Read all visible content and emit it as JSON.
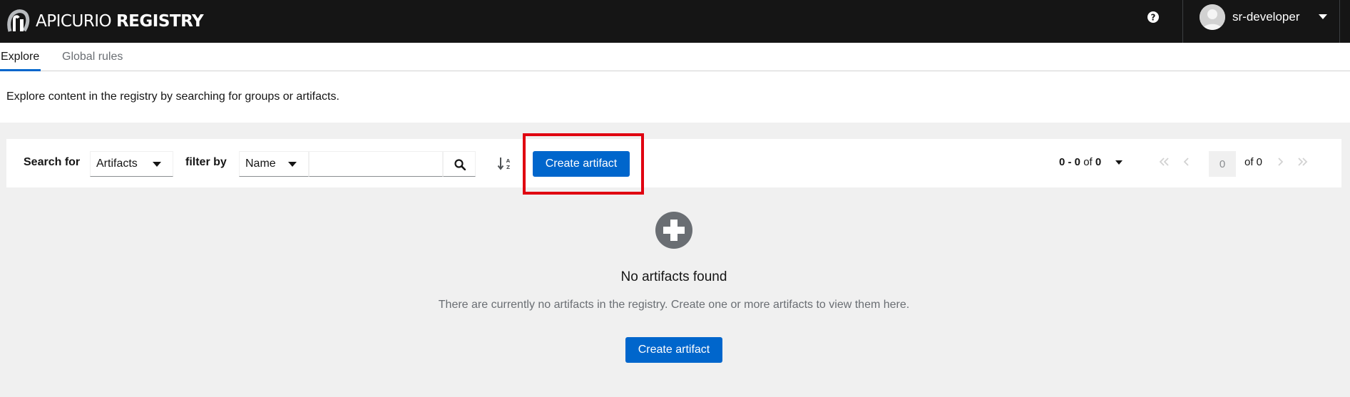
{
  "masthead": {
    "brand_light": "APICURIO",
    "brand_bold": "REGISTRY",
    "user_name": "sr-developer",
    "background_color": "#151515"
  },
  "tabs": [
    {
      "label": "Explore",
      "active": true
    },
    {
      "label": "Global rules",
      "active": false
    }
  ],
  "description": "Explore content in the registry by searching for groups or artifacts.",
  "toolbar": {
    "search_for_label": "Search for",
    "search_for_value": "Artifacts",
    "filter_by_label": "filter by",
    "filter_by_value": "Name",
    "search_value": "",
    "create_label": "Create artifact"
  },
  "pagination": {
    "range": "0 - 0",
    "of_word": "of",
    "total": "0",
    "current_page": "0",
    "page_of_label": "of 0"
  },
  "empty_state": {
    "title": "No artifacts found",
    "body": "There are currently no artifacts in the registry. Create one or more artifacts to view them here.",
    "button_label": "Create artifact"
  },
  "icons": {
    "help": "question-circle-icon",
    "sort": "sort-alpha-icon",
    "empty": "plus-circle-icon"
  },
  "colors": {
    "primary": "#0066cc",
    "highlight": "#e00010",
    "page_background": "#f0f0f0"
  }
}
